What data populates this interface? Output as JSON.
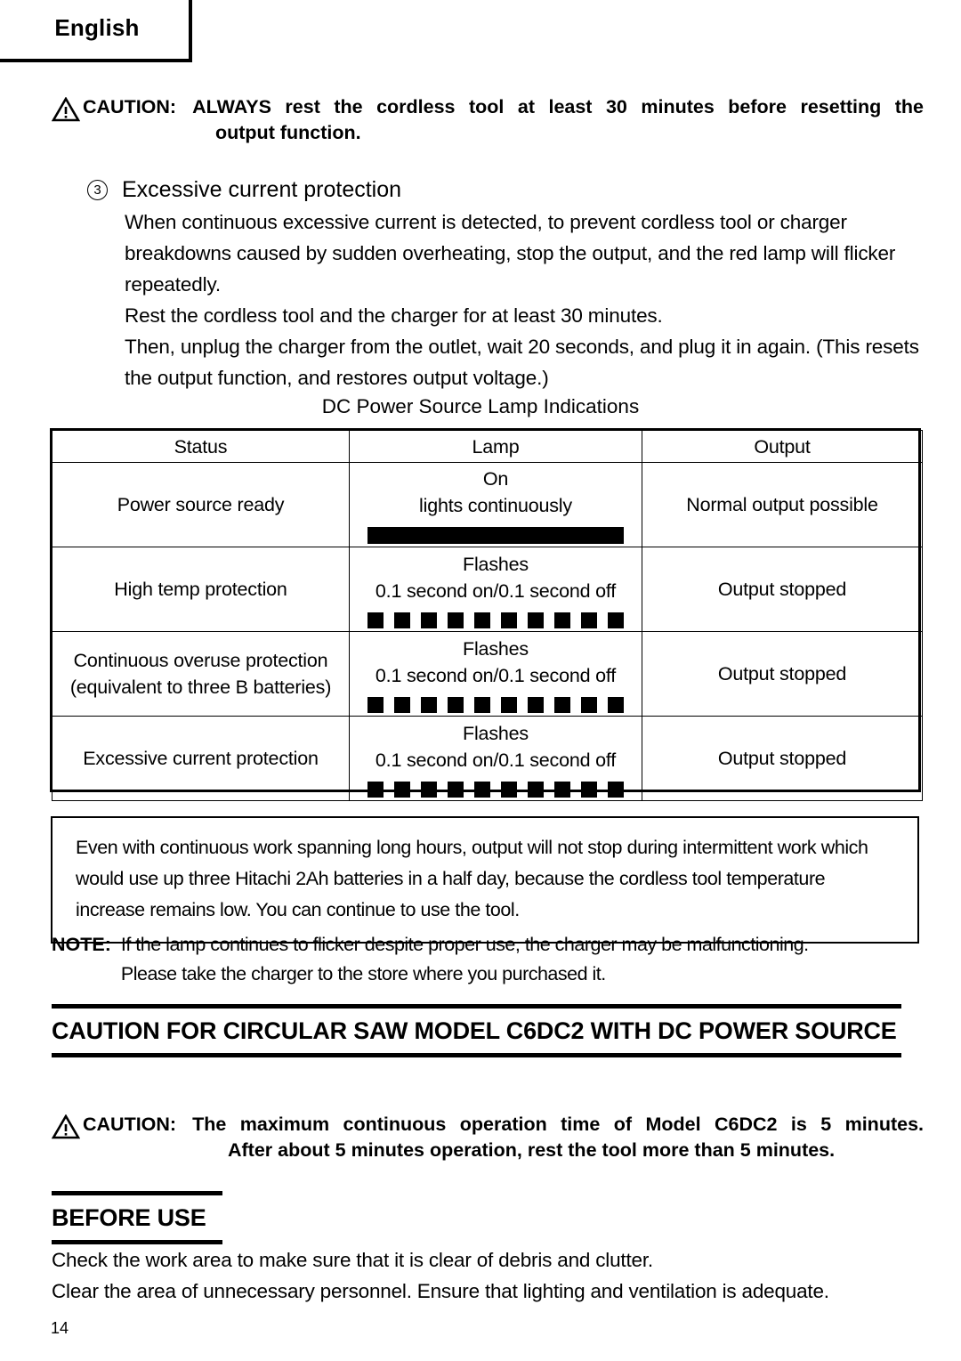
{
  "page": {
    "language_tab": "English",
    "page_number": "14"
  },
  "caution_top": {
    "icon": "warning-triangle-icon",
    "label": "CAUTION:",
    "line1": "ALWAYS rest the cordless tool at least 30 minutes before resetting the",
    "line2": "output function."
  },
  "section_item": {
    "number": "3",
    "title": "Excessive current protection",
    "paragraphs": [
      "When continuous excessive current is detected, to prevent cordless tool or charger breakdowns caused by sudden overheating, stop the output, and the red lamp will flicker repeatedly.",
      "Rest the cordless tool and the charger for at least 30 minutes.",
      "Then, unplug the charger from the outlet, wait 20 seconds, and plug it in again. (This resets the output function, and restores output voltage.)"
    ]
  },
  "table": {
    "caption": "DC Power Source Lamp Indications",
    "headers": [
      "Status",
      "Lamp",
      "Output"
    ],
    "rows": [
      {
        "status": "Power source ready",
        "lamp_line1": "On",
        "lamp_line2": "lights continuously",
        "lamp_pattern": "solid",
        "output": "Normal output possible"
      },
      {
        "status": "High temp protection",
        "lamp_line1": "Flashes",
        "lamp_line2": "0.1 second on/0.1 second off",
        "lamp_pattern": "dashes",
        "output": "Output stopped"
      },
      {
        "status": "Continuous overuse protection",
        "status_line2": "(equivalent to three B batteries)",
        "lamp_line1": "Flashes",
        "lamp_line2": "0.1 second on/0.1 second off",
        "lamp_pattern": "dashes",
        "output": "Output stopped"
      },
      {
        "status": "Excessive current protection",
        "lamp_line1": "Flashes",
        "lamp_line2": "0.1 second on/0.1 second off",
        "lamp_pattern": "dashes",
        "output": "Output stopped"
      }
    ],
    "dash_count": 10
  },
  "info_box": {
    "text": "Even with continuous work spanning long hours, output will not stop during intermittent work which would use up three Hitachi 2Ah batteries in a half day, because the cordless tool temperature increase remains low. You can continue to use the tool."
  },
  "note": {
    "label": "NOTE:",
    "line1": "If the lamp continues to flicker despite proper use, the charger may be malfunctioning.",
    "line2": "Please take the charger to the store where you purchased it."
  },
  "heading_caution_saw": "CAUTION FOR CIRCULAR SAW MODEL C6DC2 WITH DC POWER SOURCE",
  "caution_bottom": {
    "icon": "warning-triangle-icon",
    "label": "CAUTION:",
    "line1": "The maximum continuous operation time of Model C6DC2 is 5 minutes.",
    "line2": "After about 5 minutes operation, rest the tool more than 5 minutes."
  },
  "heading_before_use": "BEFORE USE",
  "closing": {
    "line1": "Check the work area to make sure that it is clear of debris and clutter.",
    "line2": "Clear the area of unnecessary personnel. Ensure that lighting and ventilation is adequate."
  }
}
